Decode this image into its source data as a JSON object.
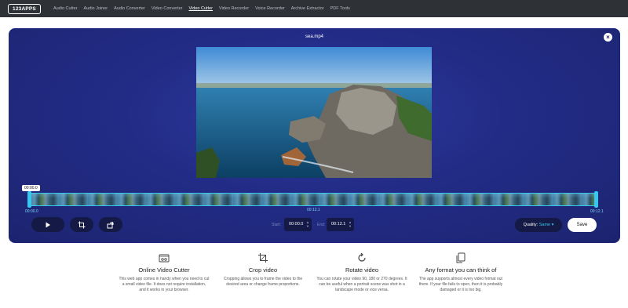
{
  "nav": {
    "logo": "123APPS",
    "items": [
      {
        "label": "Audio Cutter",
        "active": false
      },
      {
        "label": "Audio Joiner",
        "active": false
      },
      {
        "label": "Audio Converter",
        "active": false
      },
      {
        "label": "Video Converter",
        "active": false
      },
      {
        "label": "Video Cutter",
        "active": true
      },
      {
        "label": "Video Recorder",
        "active": false
      },
      {
        "label": "Voice Recorder",
        "active": false
      },
      {
        "label": "Archive Extractor",
        "active": false
      },
      {
        "label": "PDF Tools",
        "active": false
      }
    ]
  },
  "editor": {
    "filename": "sea.mp4",
    "close_icon": "close-icon",
    "timeline": {
      "cursor_time": "00:00.0",
      "start_label": "00:00.0",
      "mid_label": "00:12.1",
      "end_label": "00:12.1"
    },
    "controls": {
      "play_icon": "play-icon",
      "crop_icon": "crop-icon",
      "rotate_icon": "rotate-icon",
      "start_label": "Start:",
      "start_value": "00:00.0",
      "end_label": "End:",
      "end_value": "00:12.1",
      "quality_label": "Quality:",
      "quality_value": "Same",
      "save_label": "Save"
    }
  },
  "features": [
    {
      "icon": "video-cut-icon",
      "title": "Online Video Cutter",
      "desc": "This web app comes in handy when you need to cut a small video file. It does not require installation, and it works in your browser."
    },
    {
      "icon": "crop-icon",
      "title": "Crop video",
      "desc": "Cropping allows you to frame the video to the desired area or change frame proportions."
    },
    {
      "icon": "rotate-icon",
      "title": "Rotate video",
      "desc": "You can rotate your video 90, 180 or 270 degrees. It can be useful when a portrait scene was shot in a landscape mode or vice versa."
    },
    {
      "icon": "copy-icon",
      "title": "Any format you can think of",
      "desc": "The app supports almost every video format out there. If your file fails to open, then it is probably damaged or it is too big."
    }
  ],
  "colors": {
    "panel": "#222c86",
    "accent": "#38c8ef",
    "topbar": "#2e3136"
  }
}
